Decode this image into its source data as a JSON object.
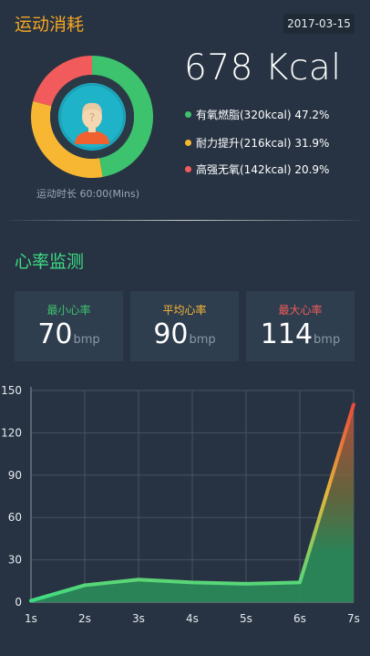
{
  "header": {
    "title": "运动消耗",
    "date": "2017-03-15"
  },
  "summary": {
    "kcal": "678 Kcal",
    "duration": "运动时长 60:00(Mins)",
    "ring_colors": {
      "aerobic": "#3dc26d",
      "endurance": "#f7b733",
      "anaerobic": "#f25b5b",
      "track": "#2b3846",
      "avatar_bg": "#1fb3c9"
    },
    "breakdown": [
      {
        "label": "有氧燃脂(320kcal) 47.2%",
        "percent": 47.2,
        "color": "#3dc26d"
      },
      {
        "label": "耐力提升(216kcal) 31.9%",
        "percent": 31.9,
        "color": "#f7b733"
      },
      {
        "label": "高强无氧(142kcal) 20.9%",
        "percent": 20.9,
        "color": "#f25b5b"
      }
    ]
  },
  "heart_rate": {
    "title": "心率监测",
    "cards": [
      {
        "label": "最小心率",
        "value": "70",
        "unit": "bmp",
        "color": "#3dc26d"
      },
      {
        "label": "平均心率",
        "value": "90",
        "unit": "bmp",
        "color": "#f7b733"
      },
      {
        "label": "最大心率",
        "value": "114",
        "unit": "bmp",
        "color": "#f25b5b"
      }
    ]
  },
  "chart_data": {
    "type": "area",
    "categories": [
      "1s",
      "2s",
      "3s",
      "4s",
      "5s",
      "6s",
      "7s"
    ],
    "series": [
      {
        "values": [
          1,
          12,
          16,
          14,
          13,
          14,
          140
        ]
      }
    ],
    "ylim": [
      0,
      150
    ],
    "yticks": [
      0,
      30,
      60,
      90,
      120,
      150
    ],
    "grid": true,
    "legend": "none",
    "colors": {
      "line_start": "#3ddc84",
      "line_end": "#ea4a3c",
      "fill": "#2a8757"
    }
  }
}
